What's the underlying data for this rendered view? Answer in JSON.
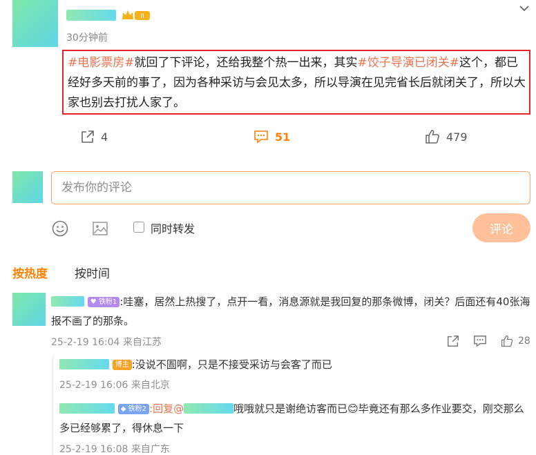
{
  "post": {
    "time": "30分钟前",
    "level_badge": "II",
    "text_segments": [
      {
        "text": "#电影票房#",
        "type": "topic"
      },
      {
        "text": "就回了下评论，还给我整个热一出来，其实",
        "type": "plain"
      },
      {
        "text": "#饺子导演已闭关#",
        "type": "topic"
      },
      {
        "text": "这个，都已经好多天前的事了，因为各种采访与会见太多，所以导演在见完省长后就闭关了，所以大家也别去打扰人家了。",
        "type": "plain"
      }
    ],
    "highlight_color": "#e8232a",
    "topic_color": "#eb7350"
  },
  "actions": {
    "share_count": "4",
    "comment_count": "51",
    "like_count": "479"
  },
  "compose": {
    "placeholder": "发布你的评论",
    "repost_label": "同时转发",
    "submit_label": "评论",
    "accent_color": "#ff8200"
  },
  "sort": {
    "hot_label": "按热度",
    "time_label": "按时间",
    "active": "按热度"
  },
  "comments": [
    {
      "badge": "铁粉1",
      "text": ":哇塞，居然上热搜了，点开一看，消息源就是我回复的那条微博，闭关？后面还有40张海报不画了的那条。",
      "meta": "25-2-19 16:04 来自江苏",
      "like_count": "28",
      "replies": [
        {
          "badge": "博主",
          "text": ":没说不圄啊，只是不接受采访与会客了而已",
          "meta": "25-2-19 16:06 来自北京"
        },
        {
          "badge": "铁粉2",
          "reply_prefix": ":回复@",
          "text_after": "哦哦就只是谢绝访客而已",
          "text_rest": "毕竟还有那么多作业要交，刚交那么多已经够累了，得休息一下",
          "meta": "25-2-19 16:08 来自广东"
        }
      ]
    }
  ]
}
